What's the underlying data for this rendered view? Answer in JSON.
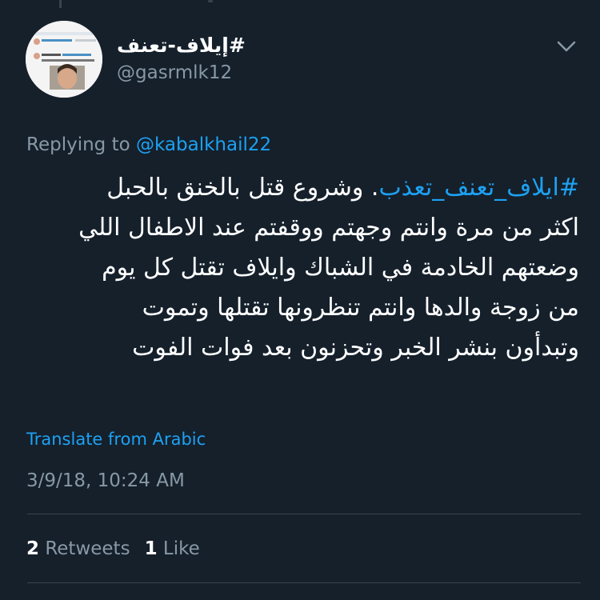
{
  "tweet": {
    "author": {
      "display_name": "#إيلاف-تعنف",
      "handle": "@gasrmlk12",
      "avatar_icon": "avatar-image-icon"
    },
    "menu_icon": "chevron-down-icon",
    "replying_prefix": "Replying to",
    "replying_to": "@kabalkhail22",
    "text_lines": [
      {
        "hashtag": "#ايلاف_تعنف_تعذب",
        "text": ". وشروع قتل بالخنق بالحبل"
      },
      {
        "hashtag": "",
        "text": "اكثر من مرة وانتم وجهتم ووقفتم عند الاطفال اللي"
      },
      {
        "hashtag": "",
        "text": "وضعتهم الخادمة في الشباك وايلاف تقتل كل يوم"
      },
      {
        "hashtag": "",
        "text": "من زوجة والدها وانتم تنظرونها تقتلها وتموت"
      },
      {
        "hashtag": "",
        "text": "وتبدأون بنشر الخبر وتحزنون بعد فوات الفوت"
      }
    ],
    "translate_label": "Translate from Arabic",
    "timestamp": "3/9/18, 10:24 AM",
    "stats": {
      "retweets_count": "2",
      "retweets_label": "Retweets",
      "likes_count": "1",
      "likes_label": "Like"
    }
  },
  "colors": {
    "background": "#15202b",
    "accent": "#1da1f2",
    "secondary_text": "#8899a6",
    "divider": "#38444d"
  }
}
